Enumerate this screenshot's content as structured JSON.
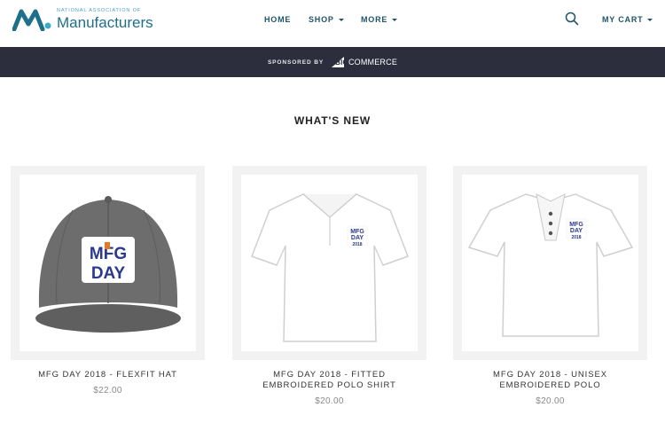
{
  "brand": {
    "small_text": "NATIONAL ASSOCIATION OF",
    "big_text": "Manufacturers"
  },
  "nav": {
    "home": "HOME",
    "shop": "SHOP",
    "more": "MORE",
    "cart": "MY CART"
  },
  "sponsor": {
    "label": "SPONSORED BY",
    "logo_big": "BIG",
    "logo_commerce": "COMMERCE"
  },
  "section": {
    "title": "WHAT'S NEW"
  },
  "products": [
    {
      "title": "MFG DAY 2018 - FLEXFIT HAT",
      "price": "$22.00",
      "image": "gray-cap"
    },
    {
      "title": "MFG DAY 2018 - FITTED EMBROIDERED POLO SHIRT",
      "price": "$20.00",
      "image": "white-polo"
    },
    {
      "title": "MFG DAY 2018 - UNISEX EMBROIDERED POLO",
      "price": "$20.00",
      "image": "white-polo-unisex"
    }
  ],
  "product_logo": {
    "line1": "MFG",
    "line2": "DAY",
    "year": "2018"
  },
  "colors": {
    "nav_text": "#1e5467",
    "sponsor_bar": "#2c2e3e",
    "brand_teal": "#1f6f8b",
    "logo_navy": "#2b3a8c",
    "logo_orange": "#e07b2a"
  }
}
